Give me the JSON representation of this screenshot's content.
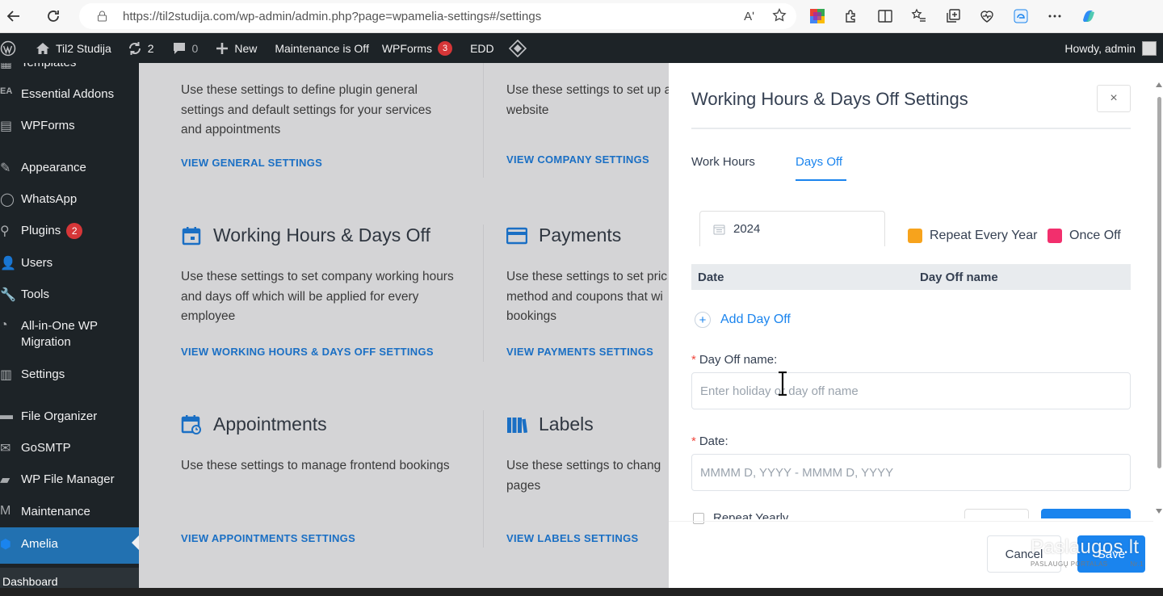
{
  "browser": {
    "url": "https://til2studija.com/wp-admin/admin.php?page=wpamelia-settings#/settings",
    "read_aloud": "Aʹ"
  },
  "adminbar": {
    "site_name": "Til2 Studija",
    "updates_count": "2",
    "comments_count": "0",
    "new_label": "New",
    "maintenance_label": "Maintenance is Off",
    "wpforms_label": "WPForms",
    "wpforms_badge": "3",
    "edd_label": "EDD",
    "howdy": "Howdy, admin"
  },
  "sidebar": {
    "items": [
      {
        "label": "Templates",
        "icon": "templates-icon"
      },
      {
        "label": "Essential Addons",
        "icon": "ea-icon"
      },
      {
        "label": "WPForms",
        "icon": "wpforms-icon"
      },
      {
        "label": "Appearance",
        "icon": "paintbrush-icon"
      },
      {
        "label": "WhatsApp",
        "icon": "whatsapp-icon"
      },
      {
        "label": "Plugins",
        "icon": "plugin-icon",
        "badge": "2"
      },
      {
        "label": "Users",
        "icon": "users-icon"
      },
      {
        "label": "Tools",
        "icon": "wrench-icon"
      },
      {
        "label": "All-in-One WP Migration",
        "icon": "migration-icon"
      },
      {
        "label": "Settings",
        "icon": "settings-icon"
      },
      {
        "label": "File Organizer",
        "icon": "folder-icon"
      },
      {
        "label": "GoSMTP",
        "icon": "mail-icon"
      },
      {
        "label": "WP File Manager",
        "icon": "file-manager-icon"
      },
      {
        "label": "Maintenance",
        "icon": "maintenance-icon"
      },
      {
        "label": "Amelia",
        "icon": "amelia-icon",
        "active": true
      }
    ],
    "submenu_first": "Dashboard"
  },
  "settings_cards": {
    "general": {
      "desc": "Use these settings to define plugin general settings and default settings for your services and appointments",
      "link": "VIEW GENERAL SETTINGS"
    },
    "company": {
      "desc": "Use these settings to set up address, phone and website",
      "link": "VIEW COMPANY SETTINGS"
    },
    "working_hours": {
      "title": "Working Hours & Days Off",
      "desc": "Use these settings to set company working hours and days off which will be applied for every employee",
      "link": "VIEW WORKING HOURS & DAYS OFF SETTINGS"
    },
    "payments": {
      "title": "Payments",
      "desc": "Use these settings to set pric method and coupons that wi bookings",
      "link": "VIEW PAYMENTS SETTINGS"
    },
    "appointments": {
      "title": "Appointments",
      "desc": "Use these settings to manage frontend bookings",
      "link": "VIEW APPOINTMENTS SETTINGS"
    },
    "labels": {
      "title": "Labels",
      "desc": "Use these settings to chang pages",
      "link": "VIEW LABELS SETTINGS"
    }
  },
  "panel": {
    "title": "Working Hours & Days Off Settings",
    "close": "×",
    "tabs": [
      "Work Hours",
      "Days Off"
    ],
    "active_tab": "Days Off",
    "year": "2024",
    "legend": [
      {
        "label": "Repeat Every Year",
        "color": "#f7a31c"
      },
      {
        "label": "Once Off",
        "color": "#f22f6d"
      }
    ],
    "table_headers": {
      "date": "Date",
      "name": "Day Off name"
    },
    "add_day_off": "Add Day Off",
    "day_off_name_label": "Day Off name:",
    "day_off_name_placeholder": "Enter holiday or day off name",
    "date_label": "Date:",
    "date_placeholder": "MMMM D, YYYY - MMMM D, YYYY",
    "repeat_yearly": "Repeat Yearly",
    "cancel": "Cancel",
    "save": "Save"
  },
  "watermark": {
    "main": "Paslaugos.lt",
    "sub_left": "PASLAUGŲ PORTALAS",
    "sub_right": "Nr.1"
  },
  "colors": {
    "wp_dark": "#1d2327",
    "wp_blue": "#2271b1",
    "amelia_blue": "#1a84ee",
    "link_blue": "#1a6fc4"
  }
}
